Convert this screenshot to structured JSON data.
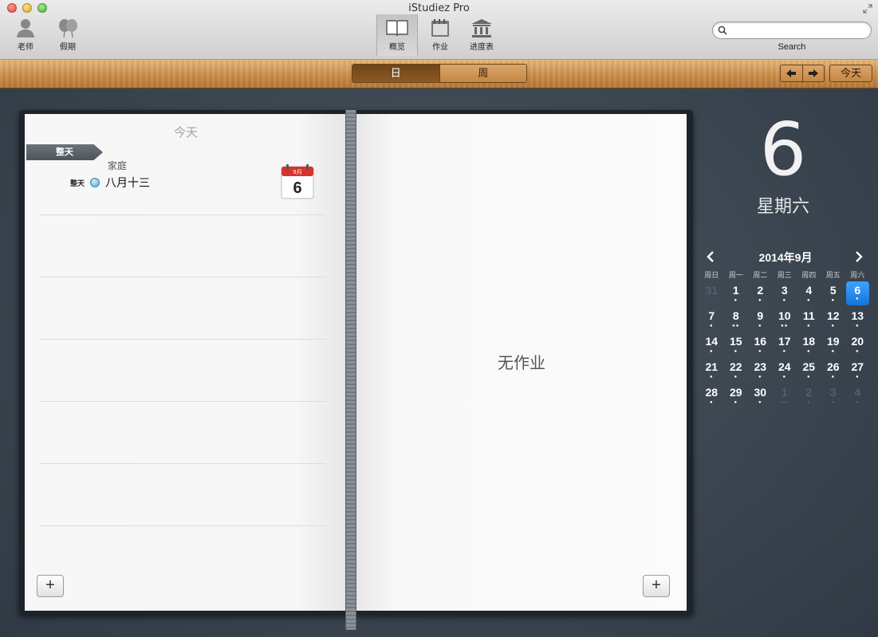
{
  "window": {
    "title": "iStudiez Pro"
  },
  "toolbar": {
    "left_buttons": [
      {
        "label": "老师",
        "icon": "person-icon"
      },
      {
        "label": "假期",
        "icon": "holiday-balloons-icon"
      }
    ],
    "center_buttons": [
      {
        "label": "概览",
        "icon": "open-book-icon",
        "active": true
      },
      {
        "label": "作业",
        "icon": "assignment-icon",
        "active": false
      },
      {
        "label": "进度表",
        "icon": "building-icon",
        "active": false
      }
    ],
    "search": {
      "placeholder": "",
      "label": "Search"
    }
  },
  "viewbar": {
    "segments": [
      {
        "label": "日",
        "active": true
      },
      {
        "label": "周",
        "active": false
      }
    ],
    "today_label": "今天"
  },
  "left_page": {
    "heading": "今天",
    "allday_tag": "整天",
    "event": {
      "category": "家庭",
      "time": "整天",
      "title": "八月十三",
      "color": "#55a8d8"
    },
    "calendar_icon": {
      "month": "9月",
      "day": "6"
    }
  },
  "right_page": {
    "empty_text": "无作业"
  },
  "side": {
    "day_number": "6",
    "weekday": "星期六",
    "calendar": {
      "title": "2014年9月",
      "weekdays": [
        "周日",
        "周一",
        "周二",
        "周三",
        "周四",
        "周五",
        "周六"
      ],
      "days": [
        {
          "d": "31",
          "dim": true,
          "dots": 0
        },
        {
          "d": "1",
          "dots": 1
        },
        {
          "d": "2",
          "dots": 1
        },
        {
          "d": "3",
          "dots": 1
        },
        {
          "d": "4",
          "dots": 1
        },
        {
          "d": "5",
          "dots": 1
        },
        {
          "d": "6",
          "dots": 1,
          "selected": true
        },
        {
          "d": "7",
          "dots": 1
        },
        {
          "d": "8",
          "dots": 2
        },
        {
          "d": "9",
          "dots": 1
        },
        {
          "d": "10",
          "dots": 2
        },
        {
          "d": "11",
          "dots": 1
        },
        {
          "d": "12",
          "dots": 1
        },
        {
          "d": "13",
          "dots": 1
        },
        {
          "d": "14",
          "dots": 1
        },
        {
          "d": "15",
          "dots": 1
        },
        {
          "d": "16",
          "dots": 1
        },
        {
          "d": "17",
          "dots": 1
        },
        {
          "d": "18",
          "dots": 1
        },
        {
          "d": "19",
          "dots": 1
        },
        {
          "d": "20",
          "dots": 1
        },
        {
          "d": "21",
          "dots": 1
        },
        {
          "d": "22",
          "dots": 1
        },
        {
          "d": "23",
          "dots": 1
        },
        {
          "d": "24",
          "dots": 1
        },
        {
          "d": "25",
          "dots": 1
        },
        {
          "d": "26",
          "dots": 1
        },
        {
          "d": "27",
          "dots": 1
        },
        {
          "d": "28",
          "dots": 1
        },
        {
          "d": "29",
          "dots": 1
        },
        {
          "d": "30",
          "dots": 1
        },
        {
          "d": "1",
          "dim": true,
          "dots": 2
        },
        {
          "d": "2",
          "dim": true,
          "dots": 1
        },
        {
          "d": "3",
          "dim": true,
          "dots": 1
        },
        {
          "d": "4",
          "dim": true,
          "dots": 1
        }
      ]
    }
  }
}
